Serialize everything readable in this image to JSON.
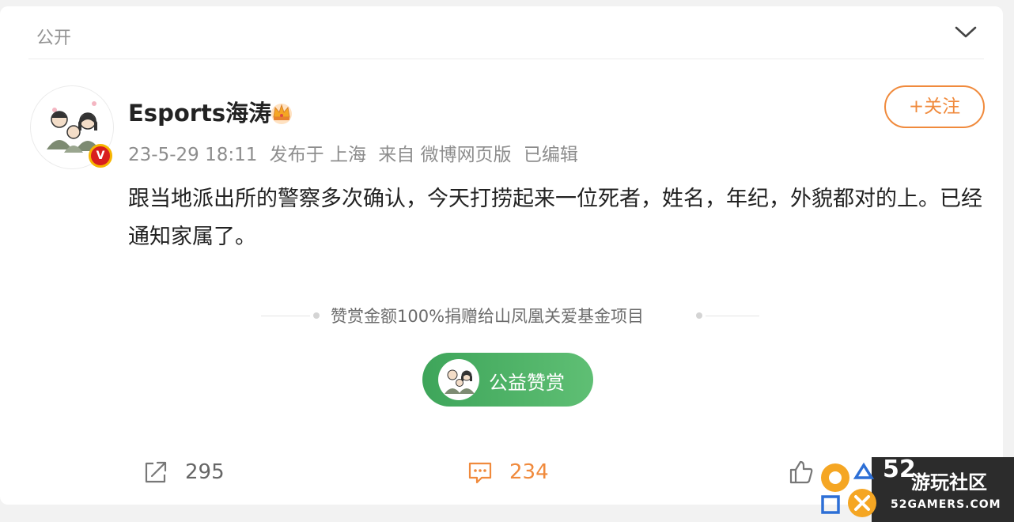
{
  "header": {
    "visibility_label": "公开",
    "dropdown_icon": "chevron-down-icon"
  },
  "post": {
    "author": {
      "name": "Esports海涛",
      "verified_badge": "V",
      "crown_icon": "crown-icon",
      "avatar_icon": "family-illustration-avatar"
    },
    "meta": {
      "time": "23-5-29 18:11",
      "location": "发布于 上海",
      "source": "来自 微博网页版",
      "edited": "已编辑"
    },
    "follow_label": "+关注",
    "text": "跟当地派出所的警察多次确认，今天打捞起来一位死者，姓名，年纪，外貌都对的上。已经通知家属了。"
  },
  "reward": {
    "note": "赞赏金额100%捐赠给山凤凰关爱基金项目",
    "button_label": "公益赞赏"
  },
  "actions": {
    "repost": {
      "icon": "share-icon",
      "count": "295"
    },
    "comment": {
      "icon": "comment-icon",
      "count": "234"
    },
    "like": {
      "icon": "thumbs-up-icon"
    }
  },
  "watermark": {
    "number": "52",
    "name": "游玩社区",
    "site": "52GAMERS.COM"
  },
  "colors": {
    "accent_orange": "#f08a3c",
    "reward_green": "#4caf62",
    "text_primary": "#222222",
    "text_secondary": "#8d8d8d"
  }
}
